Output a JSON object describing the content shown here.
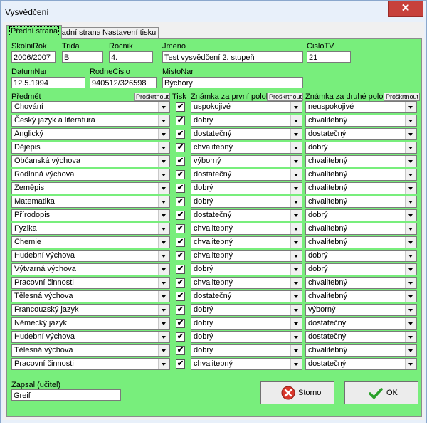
{
  "window": {
    "title": "Vysvědčení",
    "close_glyph": "✕"
  },
  "tabs": [
    "Přední strana",
    "Zadní strana",
    "Nastavení tisku"
  ],
  "fields": {
    "skolnirok": {
      "label": "SkolniRok",
      "value": "2006/2007"
    },
    "trida": {
      "label": "Trida",
      "value": "B"
    },
    "rocnik": {
      "label": "Rocnik",
      "value": "4."
    },
    "jmeno": {
      "label": "Jmeno",
      "value": "Test vysvědčení 2. stupeň"
    },
    "cislotv": {
      "label": "CisloTV",
      "value": "21"
    },
    "datumnar": {
      "label": "DatumNar",
      "value": "12.5.1994"
    },
    "rodnecislo": {
      "label": "RodneCislo",
      "value": "940512/326598"
    },
    "mistonar": {
      "label": "MistoNar",
      "value": "Býchory"
    }
  },
  "columns": {
    "subject": "Předmět",
    "print": "Tisk",
    "first": "Známka za první pololetí",
    "second": "Známka za druhé pololetí",
    "cross_out": "Proškrtnout"
  },
  "rows": [
    {
      "subject": "Chování",
      "print": true,
      "first": "uspokojivé",
      "second": "neuspokojivé"
    },
    {
      "subject": "Český jazyk a literatura",
      "print": true,
      "first": "dobrý",
      "second": "chvalitebný"
    },
    {
      "subject": "Anglický",
      "print": true,
      "first": "dostatečný",
      "second": "dostatečný"
    },
    {
      "subject": "Dějepis",
      "print": true,
      "first": "chvalitebný",
      "second": "dobrý"
    },
    {
      "subject": "Občanská výchova",
      "print": true,
      "first": "výborný",
      "second": "chvalitebný"
    },
    {
      "subject": "Rodinná výchova",
      "print": true,
      "first": "dostatečný",
      "second": "chvalitebný"
    },
    {
      "subject": "Zeměpis",
      "print": true,
      "first": "dobrý",
      "second": "chvalitebný"
    },
    {
      "subject": "Matematika",
      "print": true,
      "first": "dobrý",
      "second": "chvalitebný"
    },
    {
      "subject": "Přírodopis",
      "print": true,
      "first": "dostatečný",
      "second": "dobrý"
    },
    {
      "subject": "Fyzika",
      "print": true,
      "first": "chvalitebný",
      "second": "chvalitebný"
    },
    {
      "subject": "Chemie",
      "print": true,
      "first": "chvalitebný",
      "second": "chvalitebný"
    },
    {
      "subject": "Hudební výchova",
      "print": true,
      "first": "chvalitebný",
      "second": "dobrý"
    },
    {
      "subject": "Výtvarná výchova",
      "print": true,
      "first": "dobrý",
      "second": "dobrý"
    },
    {
      "subject": "Pracovní činnosti",
      "print": true,
      "first": "chvalitebný",
      "second": "chvalitebný"
    },
    {
      "subject": "Tělesná výchova",
      "print": true,
      "first": "dostatečný",
      "second": "chvalitebný"
    },
    {
      "subject": "Francouzský jazyk",
      "print": true,
      "first": "dobrý",
      "second": "výborný"
    },
    {
      "subject": "Německý jazyk",
      "print": true,
      "first": "dobrý",
      "second": "dostatečný"
    },
    {
      "subject": "Hudební výchova",
      "print": true,
      "first": "dobrý",
      "second": "dostatečný"
    },
    {
      "subject": "Tělesná výchova",
      "print": true,
      "first": "dobrý",
      "second": "chvalitebný"
    },
    {
      "subject": "Pracovní činnosti",
      "print": true,
      "first": "chvalitebný",
      "second": "dostatečný"
    }
  ],
  "footer": {
    "zapsal_label": "Zapsal (učitel)",
    "zapsal_value": "Greif",
    "cancel_label": "Storno",
    "ok_label": "OK"
  },
  "icons": {
    "cancel": "cancel-icon",
    "ok": "check-icon",
    "check_glyph": "✔"
  },
  "colors": {
    "form_bg": "#78ee7c",
    "cancel_red": "#d9372b",
    "ok_green": "#2aa02a"
  }
}
